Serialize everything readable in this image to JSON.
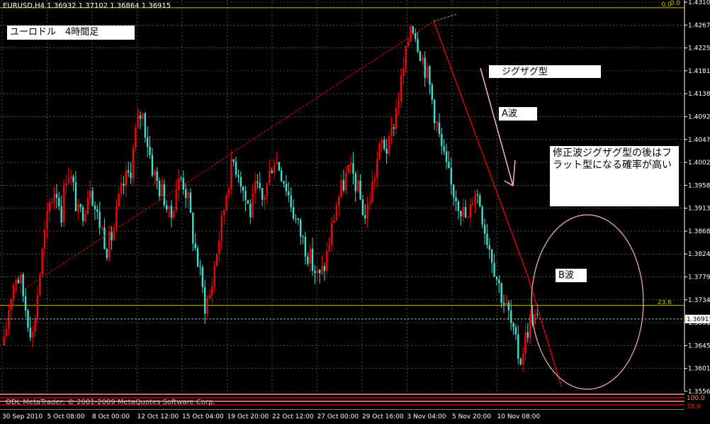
{
  "header": {
    "symbol_line": "EURUSD,H4  1.36932 1.37102 1.36864 1.36915"
  },
  "footer": {
    "copyright": "ODL MetaTrader, © 2001-2009 MetaQuotes Software Corp."
  },
  "notes": {
    "title": "ユーロドル　4時間足",
    "zigzag": "ジグザグ型",
    "wave_a": "A波",
    "correction": "修正波ジグザグ型の後はフラット型になる確率が高い",
    "wave_b": "B波"
  },
  "fibo_labels": {
    "level_0": "0.0",
    "level_236": "23.6",
    "level_1": "100.0",
    "level_2": "38.0"
  },
  "colors": {
    "background": "#000000",
    "bull": "#ff0000",
    "bear": "#40e0d0",
    "grid": "#808080",
    "fib": "#d4c000",
    "trend": "#ff0000",
    "arrow": "#ffb6b6",
    "ellipse": "#ffb6b6",
    "axis_text": "#ffffff"
  },
  "chart_data": {
    "type": "candlestick",
    "symbol": "EURUSD",
    "timeframe": "H4",
    "ylim": [
      1.355,
      1.4315
    ],
    "y_ticks": [
      "1.43105",
      "1.42675",
      "1.42250",
      "1.41810",
      "1.41385",
      "1.40920",
      "1.40475",
      "1.40020",
      "1.39580",
      "1.39130",
      "1.38680",
      "1.38240",
      "1.37790",
      "1.37340",
      "1.36915",
      "1.36450",
      "1.36010",
      "1.35560"
    ],
    "current_price": "1.36915",
    "x_tick_labels": [
      "30 Sep 2010",
      "5 Oct 08:00",
      "8 Oct 00:00",
      "12 Oct 12:00",
      "15 Oct 04:00",
      "19 Oct 20:00",
      "22 Oct 12:00",
      "27 Oct 00:00",
      "29 Oct 16:00",
      "3 Nov 04:00",
      "5 Nov 20:00",
      "10 Nov 08:00"
    ],
    "fib_levels": [
      {
        "label": "0.0",
        "price": 1.43
      },
      {
        "label": "23.6",
        "price": 1.3718
      }
    ],
    "close_path": [
      1.364,
      1.373,
      1.378,
      1.376,
      1.37,
      1.366,
      1.376,
      1.385,
      1.392,
      1.395,
      1.39,
      1.399,
      1.395,
      1.389,
      1.391,
      1.396,
      1.39,
      1.387,
      1.383,
      1.386,
      1.392,
      1.396,
      1.398,
      1.406,
      1.41,
      1.404,
      1.398,
      1.395,
      1.393,
      1.388,
      1.395,
      1.397,
      1.393,
      1.385,
      1.379,
      1.372,
      1.374,
      1.382,
      1.388,
      1.396,
      1.4,
      1.398,
      1.393,
      1.39,
      1.395,
      1.392,
      1.396,
      1.401,
      1.399,
      1.396,
      1.392,
      1.388,
      1.385,
      1.382,
      1.379,
      1.377,
      1.38,
      1.386,
      1.392,
      1.395,
      1.398,
      1.397,
      1.393,
      1.389,
      1.394,
      1.4,
      1.404,
      1.402,
      1.408,
      1.414,
      1.42,
      1.428,
      1.424,
      1.42,
      1.416,
      1.41,
      1.404,
      1.399,
      1.395,
      1.393,
      1.39,
      1.388,
      1.395,
      1.392,
      1.386,
      1.382,
      1.377,
      1.373,
      1.37,
      1.365,
      1.361,
      1.366,
      1.37,
      1.369
    ]
  }
}
